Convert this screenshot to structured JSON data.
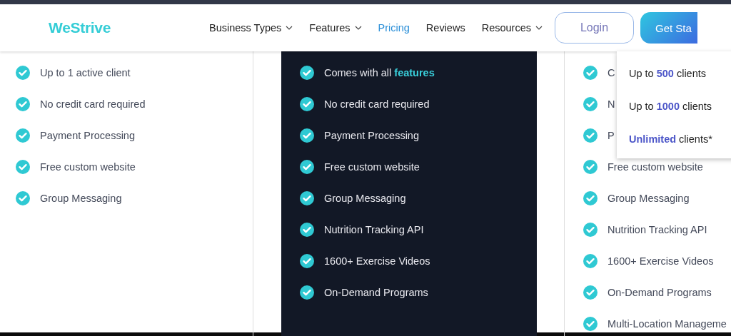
{
  "header": {
    "logo": "WeStrive",
    "nav": [
      {
        "label": "Business Types",
        "has_menu": true,
        "selected": false
      },
      {
        "label": "Features",
        "has_menu": true,
        "selected": false
      },
      {
        "label": "Pricing",
        "has_menu": false,
        "selected": true
      },
      {
        "label": "Reviews",
        "has_menu": false,
        "selected": false
      },
      {
        "label": "Resources",
        "has_menu": true,
        "selected": false
      }
    ],
    "login": "Login",
    "cta": "Get Sta"
  },
  "plans": [
    {
      "kind": "light",
      "features": [
        "Up to 1 active client",
        "No credit card required",
        "Payment Processing",
        "Free custom website",
        "Group Messaging"
      ]
    },
    {
      "kind": "dark",
      "features": [
        "Comes with all **features**",
        "No credit card required",
        "Payment Processing",
        "Free custom website",
        "Group Messaging",
        "Nutrition Tracking API",
        "1600+ Exercise Videos",
        "On-Demand Programs"
      ]
    },
    {
      "kind": "light",
      "features": [
        "C",
        "N",
        "P",
        "Free custom website",
        "Group Messaging",
        "Nutrition Tracking API",
        "1600+ Exercise Videos",
        "On-Demand Programs",
        "Multi-Location Manageme"
      ]
    }
  ],
  "client_menu": [
    "Up to **500** clients",
    "Up to **1000** clients",
    "**Unlimited** clients*"
  ]
}
